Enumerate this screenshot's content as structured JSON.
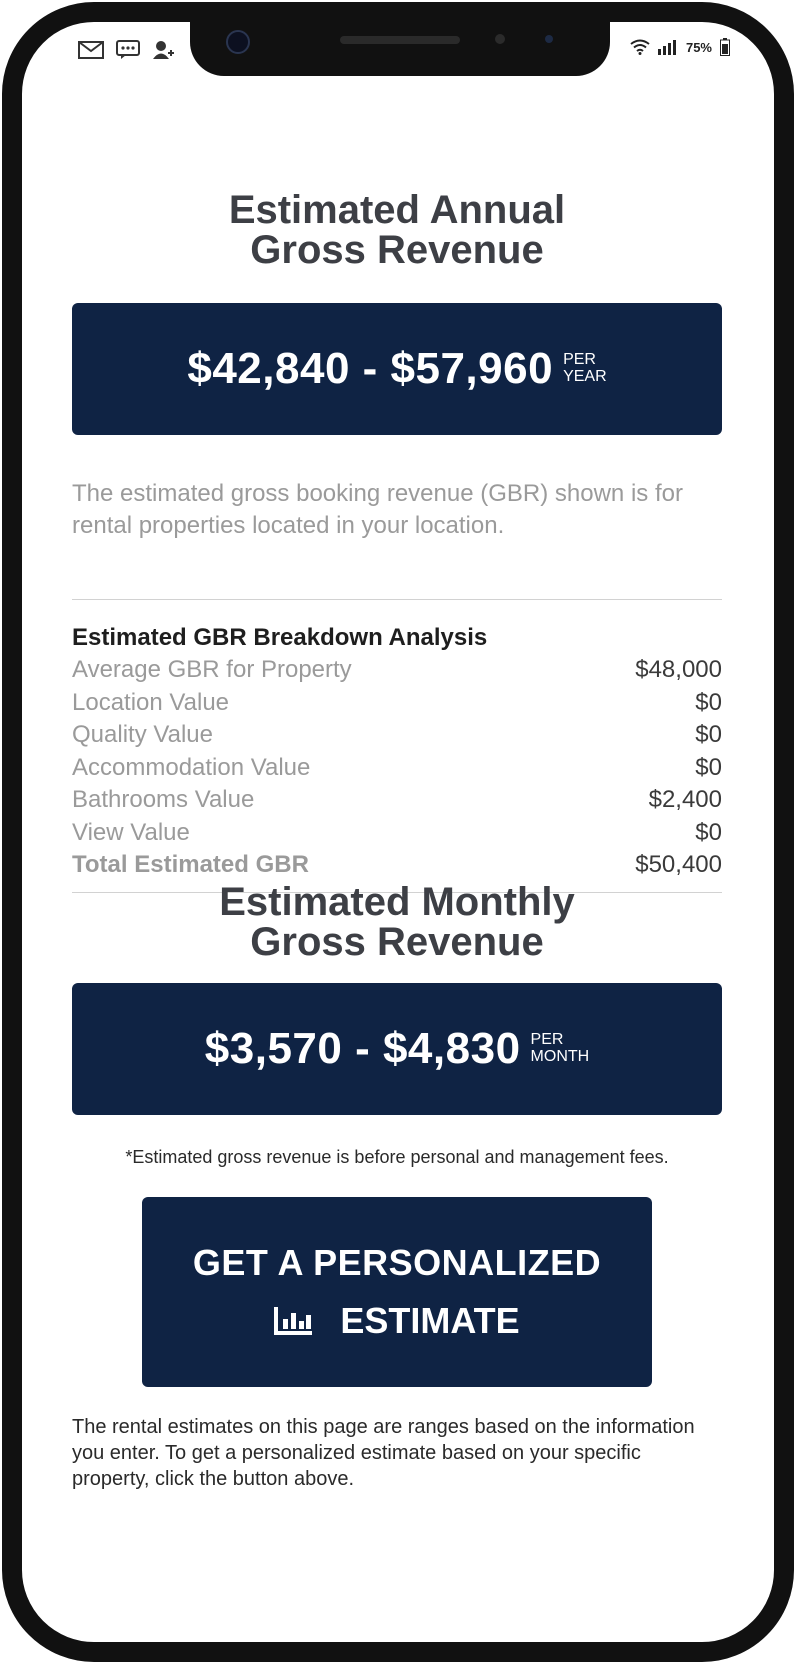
{
  "status_bar": {
    "battery": "75%",
    "icons": [
      "mail-icon",
      "message-icon",
      "add-contact-icon",
      "wifi-icon",
      "signal-icon",
      "battery-icon"
    ]
  },
  "annual": {
    "title_line1": "Estimated Annual",
    "title_line2": "Gross Revenue",
    "range": "$42,840 - $57,960",
    "unit_line1": "PER",
    "unit_line2": "YEAR"
  },
  "description": "The estimated gross booking revenue (GBR) shown is for rental properties located in your location.",
  "breakdown": {
    "title": "Estimated GBR Breakdown Analysis",
    "rows": [
      {
        "label": "Average GBR for Property",
        "value": "$48,000"
      },
      {
        "label": "Location Value",
        "value": "$0"
      },
      {
        "label": "Quality Value",
        "value": "$0"
      },
      {
        "label": "Accommodation Value",
        "value": "$0"
      },
      {
        "label": "Bathrooms Value",
        "value": "$2,400"
      },
      {
        "label": "View Value",
        "value": "$0"
      },
      {
        "label": "Total Estimated GBR",
        "value": "$50,400"
      }
    ]
  },
  "monthly": {
    "title_line1": "Estimated Monthly",
    "title_line2": "Gross Revenue",
    "range": "$3,570 - $4,830",
    "unit_line1": "PER",
    "unit_line2": "MONTH"
  },
  "footnote": "*Estimated gross revenue is before personal and management fees.",
  "cta": {
    "line1": "GET A PERSONALIZED",
    "line2": "ESTIMATE",
    "icon": "bar-chart-icon"
  },
  "bottom_note": "The rental estimates on this page are ranges based on the information you enter. To get a personalized estimate based on your specific property, click the button above.",
  "colors": {
    "navy": "#0f2344",
    "frame": "#111111",
    "muted_text": "#9a9a9a"
  }
}
